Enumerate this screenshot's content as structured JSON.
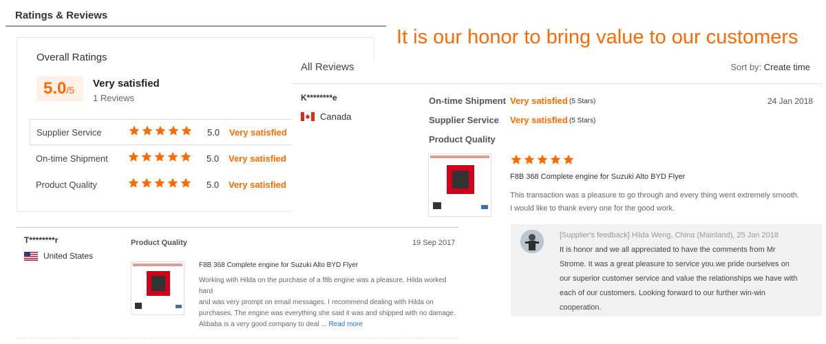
{
  "header": {
    "title": "Ratings & Reviews"
  },
  "slogan": "It is our honor to bring value to our customers",
  "overall": {
    "title": "Overall Ratings",
    "score": "5.0",
    "score_out_of": "/5",
    "status": "Very satisfied",
    "review_count": "1 Reviews",
    "rating_value": 5,
    "categories": [
      {
        "label": "Supplier Service",
        "score": "5.0",
        "status": "Very satisfied",
        "stars": 5
      },
      {
        "label": "On-time Shipment",
        "score": "5.0",
        "status": "Very satisfied",
        "stars": 5
      },
      {
        "label": "Product Quality",
        "score": "5.0",
        "status": "Very satisfied",
        "stars": 5
      }
    ]
  },
  "all_reviews": {
    "title": "All Reviews",
    "sort_label": "Sort by:",
    "sort_value": "Create time"
  },
  "review1": {
    "reviewer": "K********e",
    "country": "Canada",
    "date": "24 Jan 2018",
    "shipment_label": "On-time Shipment",
    "shipment_status": "Very satisfied",
    "shipment_stars": "(5 Stars)",
    "service_label": "Supplier Service",
    "service_status": "Very satisfied",
    "service_stars": "(5 Stars)",
    "quality_label": "Product Quality",
    "quality_rating": 5,
    "product_title": "F8B 368 Complete engine for Suzuki Alto BYD Flyer",
    "text_line1": "This transaction was a pleasure to go through and every thing went extremely smooth.",
    "text_line2": "I would like to thank every one for the good work.",
    "feedback": {
      "header": "[Supplier's feedback] Hilda Weng, China (Mainland), 25 Jan 2018",
      "line1": "It is honor and we all appreciated to have the comments from Mr",
      "line2": "Strome. It was a great pleasure to service you.we pride ourselves on",
      "line3": "our superior customer service and value the relationships we have with",
      "line4": "each of our customers. Looking forward to our further win-win",
      "line5": "cooperation."
    }
  },
  "review2": {
    "reviewer": "T********r",
    "country": "United States",
    "date": "19 Sep 2017",
    "quality_label": "Product Quality",
    "product_title": "F8B 368 Complete engine for Suzuki Alto BYD Flyer",
    "text_line1": "Working with Hilda on the purchase of a f8b engine was a pleasure. Hilda worked hard",
    "text_line2": "and was very prompt on email messages. I recommend dealing with Hilda on",
    "text_line3": "purchases. The engine was everything she said it was and shipped with no damage.",
    "text_line4": "Alibaba is a very good company to deal ...",
    "read_more": "Read more"
  },
  "colors": {
    "accent": "#ff6a00",
    "link": "#1a73c8",
    "score_bg": "#fff0e5",
    "feedback_bg": "#f1f1f1"
  },
  "icons": [
    "star-icon",
    "canada-flag-icon",
    "usa-flag-icon",
    "supplier-avatar"
  ]
}
